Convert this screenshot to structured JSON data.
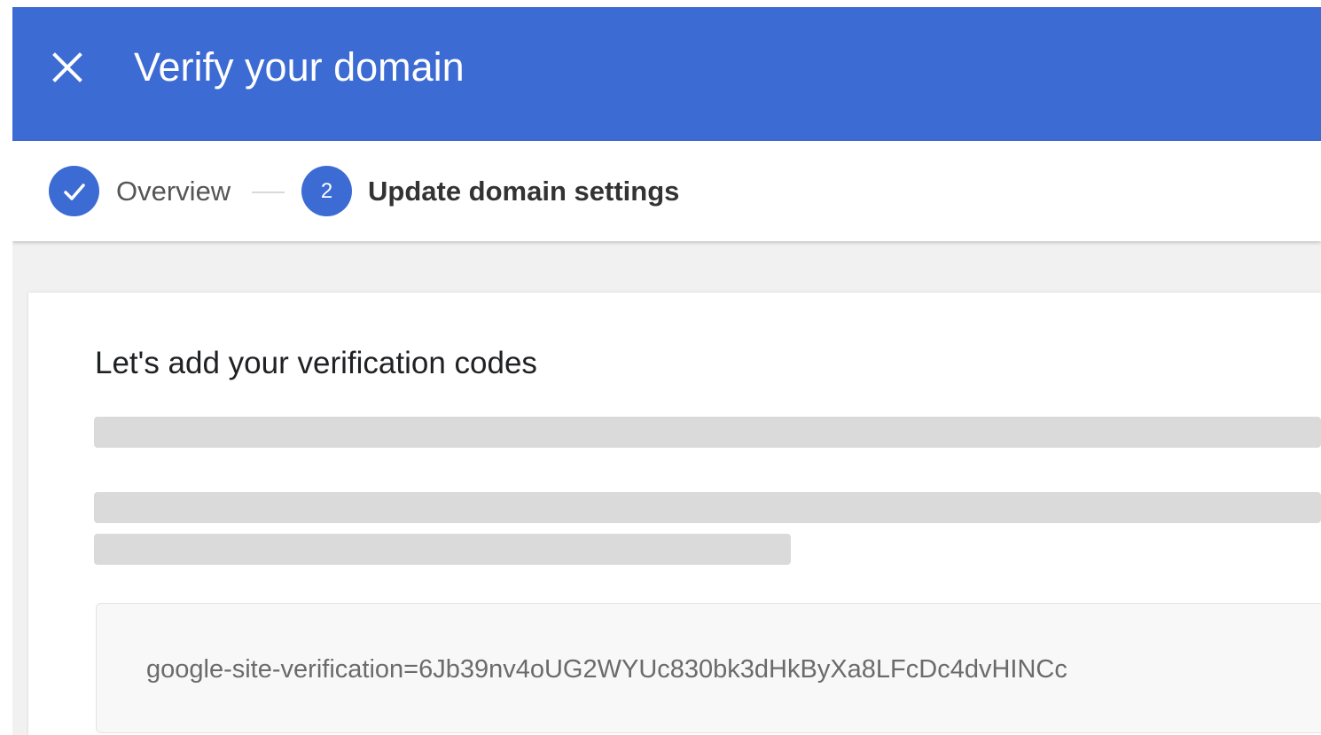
{
  "header": {
    "title": "Verify your domain",
    "close_icon": "close-icon",
    "background_color": "#3d6bd4"
  },
  "stepper": {
    "steps": [
      {
        "label": "Overview",
        "status": "completed",
        "icon": "check-icon"
      },
      {
        "label": "Update domain settings",
        "status": "active",
        "number": "2"
      }
    ]
  },
  "card": {
    "title": "Let's add your verification codes",
    "verification_code": "google-site-verification=6Jb39nv4oUG2WYUc830bk3dHkByXa8LFcDc4dvHINCc"
  },
  "colors": {
    "accent": "#3d6bd4",
    "skeleton": "#dadada",
    "page_background": "#f1f1f1"
  }
}
